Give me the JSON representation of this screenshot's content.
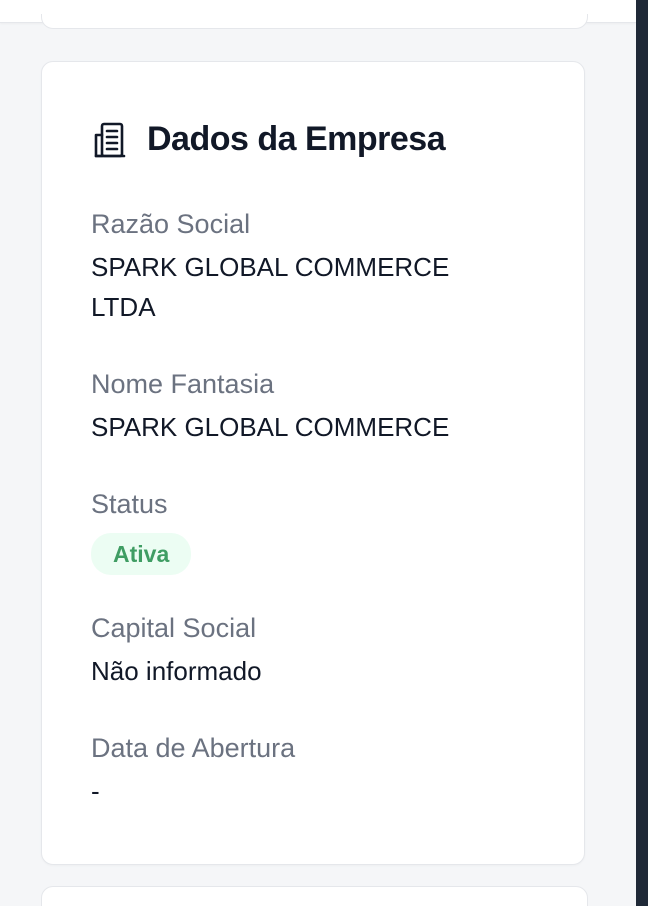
{
  "card": {
    "title": "Dados da Empresa",
    "icon": "building-icon"
  },
  "fields": {
    "razao_social": {
      "label": "Razão Social",
      "value": "SPARK GLOBAL COMMERCE LTDA"
    },
    "nome_fantasia": {
      "label": "Nome Fantasia",
      "value": "SPARK GLOBAL COMMERCE"
    },
    "status": {
      "label": "Status",
      "value": "Ativa"
    },
    "capital_social": {
      "label": "Capital Social",
      "value": "Não informado"
    },
    "data_abertura": {
      "label": "Data de Abertura",
      "value": "-"
    }
  },
  "colors": {
    "status_badge_bg": "#ecfdf3",
    "status_badge_text": "#3f9d63"
  }
}
